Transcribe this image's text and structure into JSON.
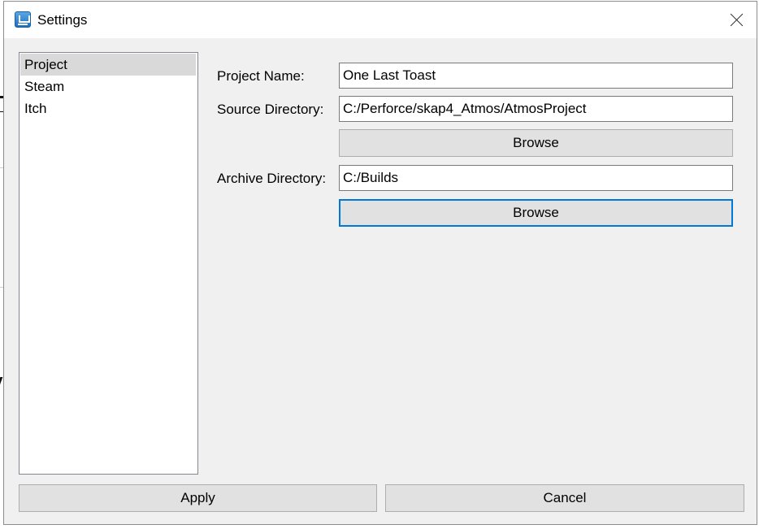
{
  "window": {
    "title": "Settings"
  },
  "sidebar": {
    "items": [
      {
        "label": "Project",
        "selected": true
      },
      {
        "label": "Steam",
        "selected": false
      },
      {
        "label": "Itch",
        "selected": false
      }
    ]
  },
  "project": {
    "name_label": "Project Name:",
    "name_value": "One Last Toast",
    "source_label": "Source Directory:",
    "source_value": "C:/Perforce/skap4_Atmos/AtmosProject",
    "source_browse": "Browse",
    "archive_label": "Archive Directory:",
    "archive_value": "C:/Builds",
    "archive_browse": "Browse"
  },
  "footer": {
    "apply_label": "Apply",
    "cancel_label": "Cancel"
  },
  "colors": {
    "dialog_bg": "#f0f0f0",
    "selection": "#d9d9d9",
    "focus_accent": "#0078d7"
  },
  "icons": {
    "app": "app-icon",
    "close": "close-icon"
  }
}
